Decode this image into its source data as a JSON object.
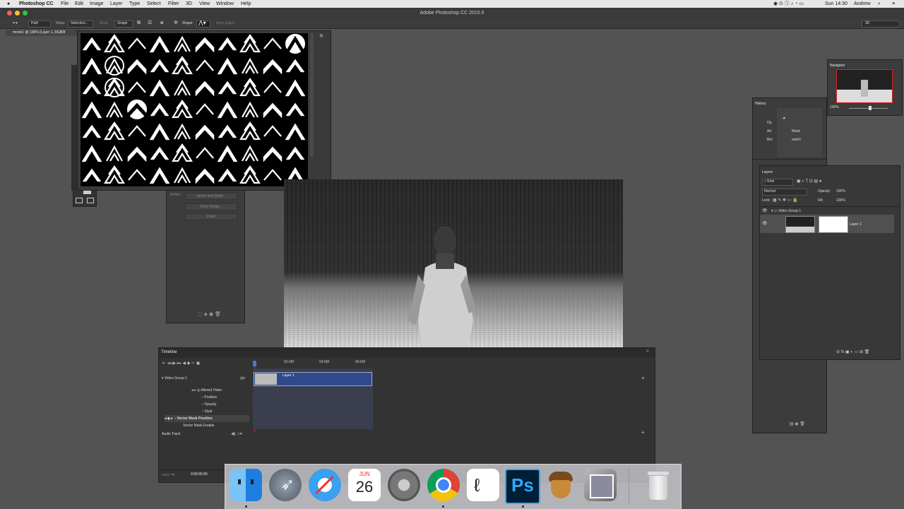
{
  "menubar": {
    "apple": "",
    "app": "Photoshop CC",
    "items": [
      "File",
      "Edit",
      "Image",
      "Layer",
      "Type",
      "Select",
      "Filter",
      "3D",
      "View",
      "Window",
      "Help"
    ],
    "clock": "Sun 14:30",
    "user": "Andrew"
  },
  "window": {
    "title": "Adobe Photoshop CC 2015.5"
  },
  "options": {
    "mode": "Path",
    "make_label": "Make:",
    "selection_button": "Selection...",
    "mask_button": "Mask",
    "shape_button": "Shape",
    "shape_label": "Shape:",
    "align_edges": "Align Edges",
    "workspace": "3D"
  },
  "document": {
    "tab": "movie1 @ 100% (Layer 1, RGB/8"
  },
  "mask_panel": {
    "refine_label": "Refine:",
    "buttons": [
      "Select and Mask...",
      "Color Range...",
      "Invert"
    ]
  },
  "timeline": {
    "title": "Timeline",
    "times": [
      "02:00f",
      "04:00f",
      "06:00f"
    ],
    "group": "Video Group 1",
    "clip": "Layer 1",
    "rows": [
      "Altered Video",
      "Position",
      "Opacity",
      "Style",
      "Vector Mask Position",
      "Vector Mask Enable"
    ],
    "audio": "Audio Track",
    "timecode": "0:00:00:00"
  },
  "navigator": {
    "title": "Navigator",
    "zoom": "100%"
  },
  "history": {
    "title": "History",
    "items": [
      "Op",
      "Ad",
      "Bre"
    ],
    "side_items": [
      "Mask",
      "watch"
    ]
  },
  "layers": {
    "title": "Layers",
    "filter": "Kind",
    "blend": "Normal",
    "opacity_label": "Opacity:",
    "opacity": "100%",
    "lock_label": "Lock:",
    "fill_label": "Fill:",
    "fill": "100%",
    "group": "Video Group 1",
    "layer": "Layer 1"
  },
  "dock": {
    "calendar_month": "JUN",
    "calendar_day": "26",
    "ps_label": "Ps",
    "apps": [
      "finder-icon",
      "launchpad-icon",
      "safari-icon",
      "calendar-icon",
      "system-preferences-icon",
      "chrome-icon",
      "line-app-icon",
      "photoshop-icon",
      "acorn-icon",
      "preview-icon",
      "trash-icon"
    ]
  },
  "colors": {
    "accent": "#2f4a8c",
    "ps_blue": "#31a8ff",
    "panel": "#3c3c3c"
  }
}
